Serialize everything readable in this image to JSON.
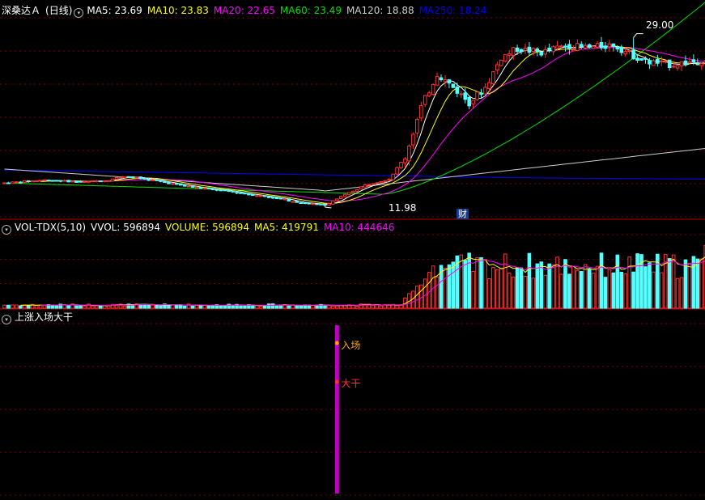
{
  "main_legend": {
    "stock_name": "深桑达Ａ",
    "period": "(日线)",
    "items": [
      {
        "label": "MA5: 23.69",
        "color": "#ffffff"
      },
      {
        "label": "MA10: 23.83",
        "color": "#ffff00"
      },
      {
        "label": "MA20: 22.65",
        "color": "#ff00ff"
      },
      {
        "label": "MA60: 23.49",
        "color": "#00e000"
      },
      {
        "label": "MA120: 18.88",
        "color": "#cccccc"
      },
      {
        "label": "MA250: 18.24",
        "color": "#0000ff"
      }
    ]
  },
  "vol_legend": {
    "name": "VOL-TDX(5,10)",
    "items": [
      {
        "label": "VVOL: 596894",
        "color": "#ffffff"
      },
      {
        "label": "VOLUME: 596894",
        "color": "#ffff00"
      },
      {
        "label": "MA5: 419791",
        "color": "#ffff00"
      },
      {
        "label": "MA10: 444646",
        "color": "#ff00ff"
      }
    ]
  },
  "indicator_legend": {
    "name": "上涨入场大干"
  },
  "annotations": {
    "price_high": "29.00",
    "price_low": "11.98",
    "badge": "财",
    "signal_entry": "入场",
    "signal_go": "大干"
  },
  "colors": {
    "up": "#ff3232",
    "down": "#54ffff",
    "grid": "#7a0000",
    "separator": "#b00000",
    "signal_bar": "#c000c0",
    "entry_text": "#ffa500",
    "go_text": "#ff3030"
  },
  "chart_data": {
    "type": "candlestick",
    "price_ylim": [
      11,
      31
    ],
    "volume_ylim": [
      0,
      700000
    ],
    "signal_index": 83,
    "candles": []
  }
}
